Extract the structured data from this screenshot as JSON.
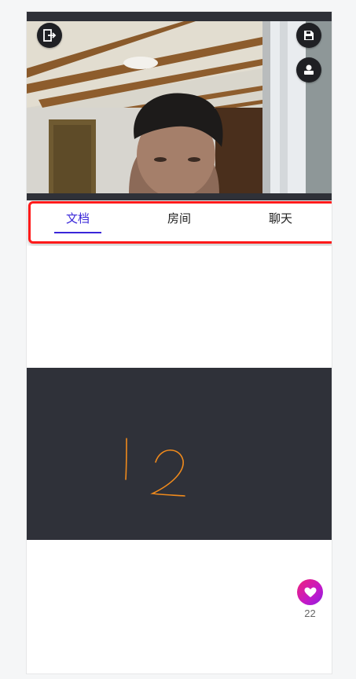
{
  "video": {
    "exit_icon": "exit-icon",
    "save_icon": "save-icon",
    "user_icon": "user-icon"
  },
  "tabs": [
    {
      "label": "文档",
      "active": true
    },
    {
      "label": "房间",
      "active": false
    },
    {
      "label": "聊天",
      "active": false
    }
  ],
  "whiteboard": {
    "stroke_color": "#f08a1c"
  },
  "like": {
    "count": "22",
    "icon": "heart-icon"
  },
  "colors": {
    "accent": "#3a27d9",
    "highlight_border": "#ff1a1a",
    "whiteboard_bg": "#2f3139",
    "like_gradient_start": "#f0237a",
    "like_gradient_end": "#8b1ee0"
  }
}
